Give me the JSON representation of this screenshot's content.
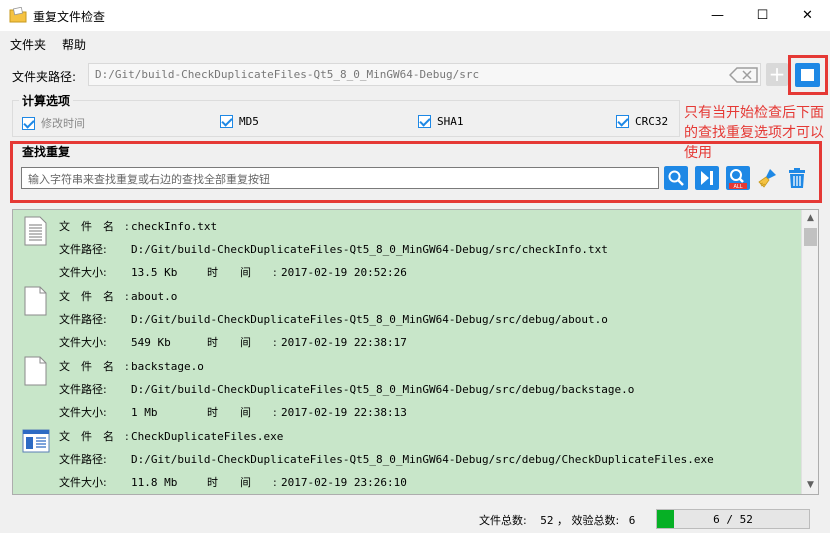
{
  "window": {
    "title": "重复文件检查",
    "minimize_glyph": "—",
    "maximize_glyph": "☐",
    "close_glyph": "✕"
  },
  "menu": [
    "文件夹",
    "帮助"
  ],
  "folder": {
    "label": "文件夹路径:",
    "path": "D:/Git/build-CheckDuplicateFiles-Qt5_8_0_MinGW64-Debug/src",
    "add_glyph": "+"
  },
  "calc_options": {
    "title": "计算选项",
    "options": [
      {
        "label": "修改时间",
        "checked": true,
        "disabled": true
      },
      {
        "label": "MD5",
        "checked": true,
        "disabled": false
      },
      {
        "label": "SHA1",
        "checked": true,
        "disabled": false
      },
      {
        "label": "CRC32",
        "checked": true,
        "disabled": false
      }
    ]
  },
  "annotation": "只有当开始检查后下面的查找重复选项才可以使用",
  "find": {
    "title": "查找重复",
    "placeholder": "输入字符串来查找重复或右边的查找全部重复按钮"
  },
  "field_labels": {
    "name": "文件名:",
    "path": "文件路径:",
    "size": "文件大小:",
    "time": "时间:"
  },
  "files": [
    {
      "icon": "text-file-icon",
      "name": "checkInfo.txt",
      "path": "D:/Git/build-CheckDuplicateFiles-Qt5_8_0_MinGW64-Debug/src/checkInfo.txt",
      "size": "13.5 Kb",
      "time": "2017-02-19 20:52:26"
    },
    {
      "icon": "blank-file-icon",
      "name": "about.o",
      "path": "D:/Git/build-CheckDuplicateFiles-Qt5_8_0_MinGW64-Debug/src/debug/about.o",
      "size": "549 Kb",
      "time": "2017-02-19 22:38:17"
    },
    {
      "icon": "blank-file-icon",
      "name": "backstage.o",
      "path": "D:/Git/build-CheckDuplicateFiles-Qt5_8_0_MinGW64-Debug/src/debug/backstage.o",
      "size": "1 Mb",
      "time": "2017-02-19 22:38:13"
    },
    {
      "icon": "exe-file-icon",
      "name": "CheckDuplicateFiles.exe",
      "path": "D:/Git/build-CheckDuplicateFiles-Qt5_8_0_MinGW64-Debug/src/debug/CheckDuplicateFiles.exe",
      "size": "11.8 Mb",
      "time": "2017-02-19 23:26:10"
    }
  ],
  "status": {
    "total_label": "文件总数:",
    "total": "52",
    "separator": "，",
    "checked_label": "效验总数:",
    "checked": "6",
    "progress_text": "6 / 52",
    "progress_fraction": 0.115
  },
  "colors": {
    "accent": "#1e88e5",
    "highlight_red": "#e53935",
    "list_background": "#c8e6c9",
    "progress_green": "#06b025"
  }
}
